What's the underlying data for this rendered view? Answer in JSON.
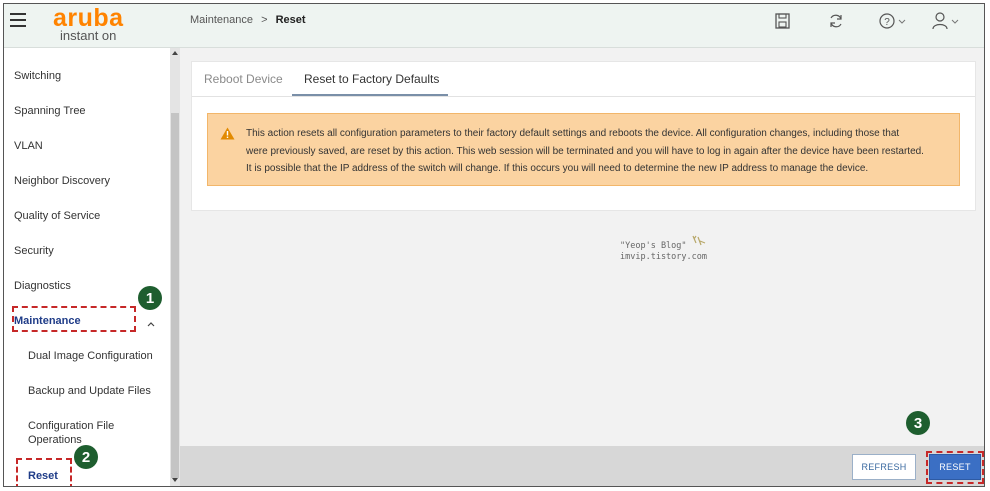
{
  "header": {
    "logo_brand": "aruba",
    "logo_sub": "instant on",
    "breadcrumb_parent": "Maintenance",
    "breadcrumb_sep": ">",
    "breadcrumb_current": "Reset"
  },
  "sidebar": {
    "items": [
      {
        "label": "Switching"
      },
      {
        "label": "Spanning Tree"
      },
      {
        "label": "VLAN"
      },
      {
        "label": "Neighbor Discovery"
      },
      {
        "label": "Quality of Service"
      },
      {
        "label": "Security"
      },
      {
        "label": "Diagnostics"
      },
      {
        "label": "Maintenance"
      }
    ],
    "sub_items": [
      {
        "label": "Dual Image Configuration"
      },
      {
        "label": "Backup and Update Files"
      },
      {
        "label": "Configuration File Operations"
      },
      {
        "label": "Reset"
      }
    ]
  },
  "tabs": [
    {
      "label": "Reboot Device",
      "active": false
    },
    {
      "label": "Reset to Factory Defaults",
      "active": true
    }
  ],
  "alert": {
    "line1": "This action resets all configuration parameters to their factory default settings and reboots the device. All configuration changes, including those that",
    "line2": "were previously saved, are reset by this action. This web session will be terminated and you will have to log in again after the device have been restarted.",
    "line3": "It is possible that the IP address of the switch will change. If this occurs you will need to determine the new IP address to manage the device."
  },
  "watermark": {
    "line1": "\"Yeop's Blog\"",
    "line2": "imvip.tistory.com"
  },
  "annotations": {
    "step1": "1",
    "step2": "2",
    "step3": "3"
  },
  "footer": {
    "refresh_label": "REFRESH",
    "reset_label": "RESET"
  },
  "colors": {
    "brand_orange": "#ff8300",
    "header_bg": "#eef4f1",
    "alert_bg": "#fbd3a1",
    "primary_button": "#3b6fc4",
    "annotation_red": "#c62828",
    "annotation_badge": "#1e5e2f"
  },
  "icons": [
    "hamburger-icon",
    "save-icon",
    "refresh-icon",
    "help-icon",
    "user-icon",
    "chevron-up-icon",
    "warning-icon"
  ]
}
